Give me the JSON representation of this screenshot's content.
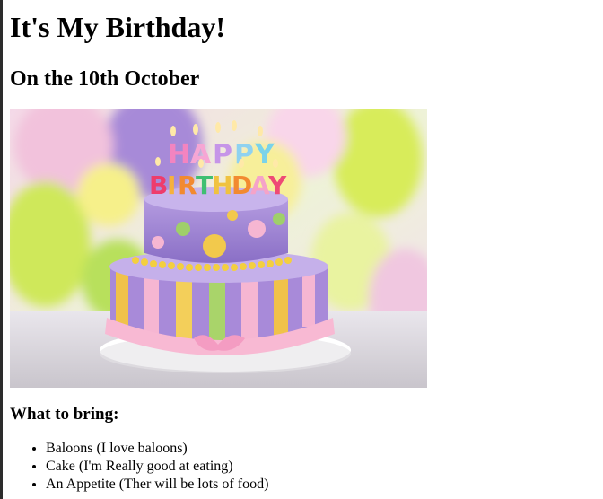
{
  "page": {
    "title": "It's My Birthday!",
    "subtitle": "On the 10th October",
    "section_heading": "What to bring:",
    "items": [
      "Baloons (I love baloons)",
      "Cake (I'm Really good at eating)",
      "An Appetite (Ther will be lots of food)"
    ]
  },
  "image": {
    "description_icon": "birthday-cake-photo",
    "cake_topper_line1": "HAPPY",
    "cake_topper_line2": "BIRTHDAY"
  },
  "colors": {
    "background": "#ffffff",
    "text": "#000000",
    "cake_top": "#9b7fd0",
    "cake_pink": "#f6b4d0",
    "balloon_yellow": "#e8f06a"
  }
}
